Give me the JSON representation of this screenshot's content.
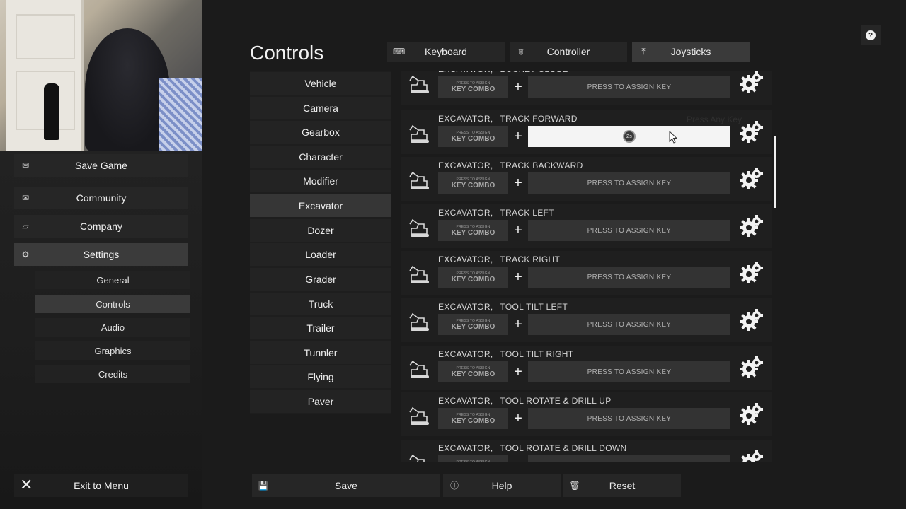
{
  "sidebar": {
    "main_items": [
      {
        "label": "Save Game",
        "icon": "envelope-icon"
      },
      {
        "label": "Community",
        "icon": "envelope-icon"
      },
      {
        "label": "Company",
        "icon": "briefcase-icon"
      },
      {
        "label": "Settings",
        "icon": "gear-icon",
        "active": true
      }
    ],
    "settings_items": [
      {
        "label": "General"
      },
      {
        "label": "Controls",
        "active": true
      },
      {
        "label": "Audio"
      },
      {
        "label": "Graphics"
      },
      {
        "label": "Credits"
      }
    ],
    "exit_label": "Exit to Menu"
  },
  "page": {
    "title": "Controls"
  },
  "tabs": [
    {
      "label": "Keyboard",
      "icon": "keyboard-icon"
    },
    {
      "label": "Controller",
      "icon": "gamepad-icon"
    },
    {
      "label": "Joysticks",
      "icon": "joystick-icon",
      "active": true
    }
  ],
  "categories": [
    "Vehicle",
    "Camera",
    "Gearbox",
    "Character",
    "Modifier",
    "Excavator",
    "Dozer",
    "Loader",
    "Grader",
    "Truck",
    "Trailer",
    "Tunnler",
    "Flying",
    "Paver"
  ],
  "active_category": "Excavator",
  "binding_defaults": {
    "combo_small": "PRESS TO ASSIGN",
    "combo_big": "KEY COMBO",
    "plus": "+",
    "assign_label": "PRESS TO ASSIGN KEY"
  },
  "bindings": [
    {
      "group": "EXCAVATOR,",
      "action": "BUCKET CLOSE"
    },
    {
      "group": "EXCAVATOR,",
      "action": "TRACK FORWARD",
      "listening": true,
      "hint": "Press Any Key...",
      "listen_glyph": "2s"
    },
    {
      "group": "EXCAVATOR,",
      "action": "TRACK BACKWARD"
    },
    {
      "group": "EXCAVATOR,",
      "action": "TRACK LEFT"
    },
    {
      "group": "EXCAVATOR,",
      "action": "TRACK RIGHT"
    },
    {
      "group": "EXCAVATOR,",
      "action": "TOOL TILT LEFT"
    },
    {
      "group": "EXCAVATOR,",
      "action": "TOOL TILT RIGHT"
    },
    {
      "group": "EXCAVATOR,",
      "action": "TOOL ROTATE & DRILL UP"
    },
    {
      "group": "EXCAVATOR,",
      "action": "TOOL ROTATE & DRILL DOWN"
    }
  ],
  "bottom_bar": {
    "save": "Save",
    "help": "Help",
    "reset": "Reset"
  },
  "help_icon": "?"
}
